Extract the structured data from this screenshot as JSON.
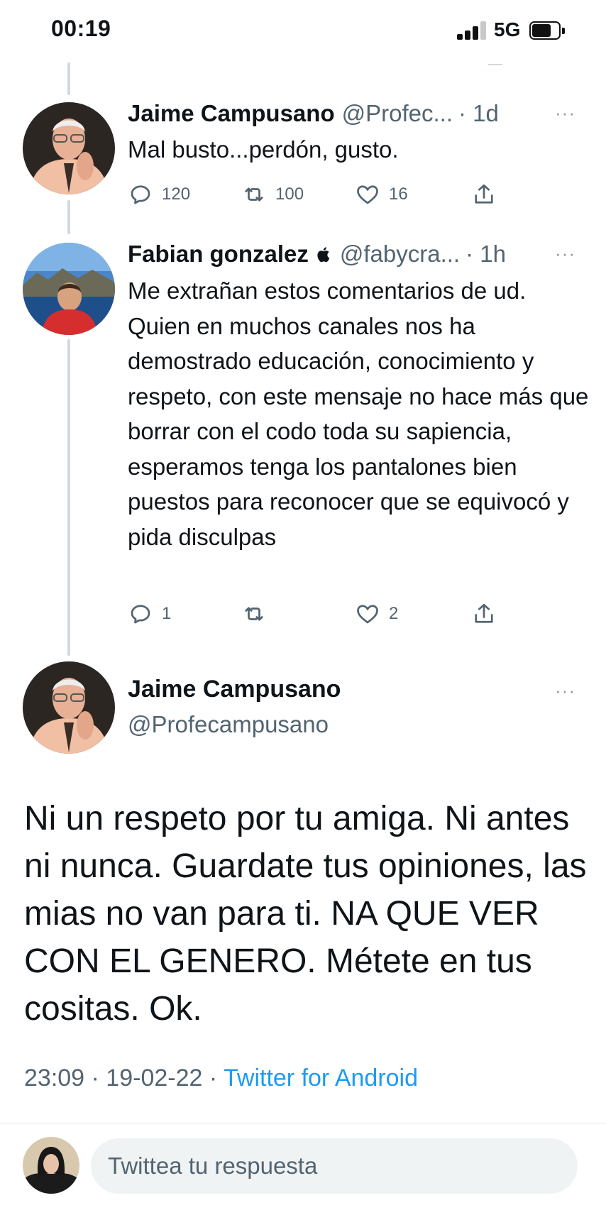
{
  "status_bar": {
    "time": "00:19",
    "network": "5G",
    "icons": [
      "cellular-signal-icon",
      "battery-icon"
    ]
  },
  "thread": [
    {
      "author": "Jaime Campusano",
      "handle": "@Profec...",
      "time": "· 1d",
      "text": "Mal busto...perdón, gusto.",
      "actions": {
        "replies": "120",
        "retweets": "100",
        "likes": "16"
      }
    },
    {
      "author": "Fabian gonzalez",
      "badge_icon": "apple-icon",
      "handle": "@fabycra...",
      "time": "· 1h",
      "text": "Me extrañan estos comentarios de ud. Quien en muchos canales nos ha demostrado educación, conocimiento y respeto, con este mensaje no hace más que borrar con el codo toda su sapiencia, esperamos tenga los pantalones bien puestos para reconocer que se equivocó y pida disculpas",
      "actions": {
        "replies": "1",
        "retweets": "",
        "likes": "2"
      }
    }
  ],
  "main_tweet": {
    "author": "Jaime Campusano",
    "handle": "@Profecampusano",
    "text": "Ni un respeto por tu amiga. Ni antes ni nunca. Guardate tus opiniones, las mias no van para ti. NA  QUE VER CON EL GENERO. Métete en tus cositas. Ok.",
    "timestamp": "23:09 · 19-02-22 · ",
    "source": "Twitter for Android"
  },
  "reply_box": {
    "placeholder": "Twittea tu respuesta"
  },
  "more_label": "···",
  "colors": {
    "text": "#0f1419",
    "secondary": "#536471",
    "accent": "#1d9bf0",
    "thread_line": "#cfd9de",
    "reply_field": "#eff3f4"
  }
}
